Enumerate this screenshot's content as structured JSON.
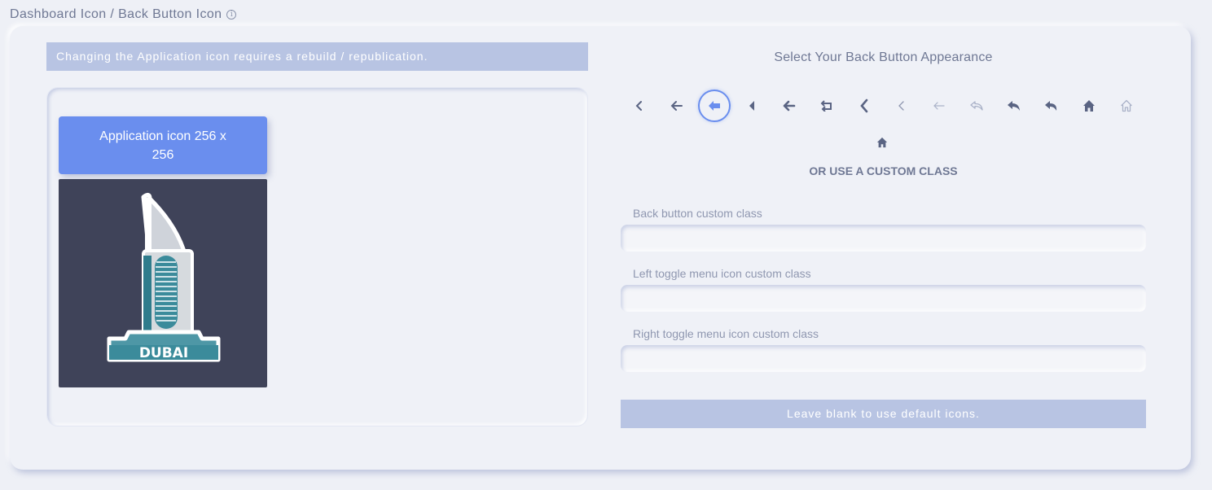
{
  "header": {
    "title": "Dashboard Icon / Back Button Icon",
    "info_icon": "info-icon"
  },
  "left": {
    "notice": "Changing the Application icon requires a rebuild / republication.",
    "app_icon_button": "Application icon 256 x 256",
    "app_icon_text": "DUBAI"
  },
  "right": {
    "title": "Select Your Back Button Appearance",
    "back_icons": [
      "chevron-left-icon",
      "arrow-left-icon",
      "circle-arrow-left-icon",
      "caret-left-icon",
      "bold-arrow-left-icon",
      "return-icon",
      "thick-chevron-left-icon",
      "thin-chevron-left-icon",
      "thin-arrow-left-icon",
      "reply-outline-icon",
      "reply-icon",
      "reply-solid-icon",
      "home-icon",
      "home-outline-icon",
      "home-small-icon"
    ],
    "selected_icon": "circle-arrow-left-icon",
    "custom_heading": "OR USE A CUSTOM CLASS",
    "fields": [
      {
        "label": "Back button custom class",
        "value": ""
      },
      {
        "label": "Left toggle menu icon custom class",
        "value": ""
      },
      {
        "label": "Right toggle menu icon custom class",
        "value": ""
      }
    ],
    "hint": "Leave blank to use default icons."
  },
  "colors": {
    "accent": "#6a8eee",
    "banner": "#b8c4e3",
    "icon_dark": "#5a6483",
    "icon_light": "#aab2c8",
    "preview_bg": "#3f4359"
  }
}
